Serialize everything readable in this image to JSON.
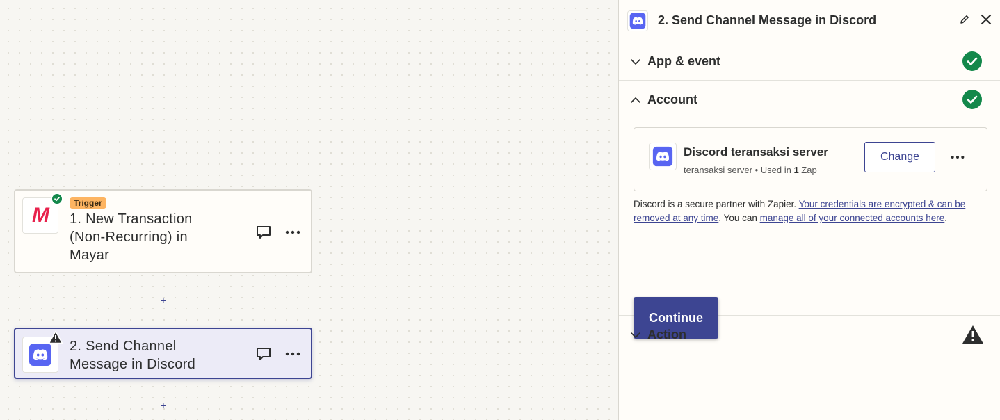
{
  "canvas": {
    "trigger_step": {
      "pill": "Trigger",
      "title": "1. New Transaction (Non-Recurring) in Mayar",
      "logo_letter": "M"
    },
    "action_step": {
      "title": "2. Send Channel Message in Discord"
    },
    "add_step_symbol": "+"
  },
  "panel": {
    "title": "2. Send Channel Message in Discord",
    "sections": {
      "app_event": {
        "label": "App & event",
        "status": "complete"
      },
      "account": {
        "label": "Account",
        "status": "complete"
      },
      "action": {
        "label": "Action",
        "status": "warning"
      }
    },
    "account_card": {
      "name": "Discord teransaksi server",
      "sub_prefix": "teransaksi server • Used in ",
      "sub_count": "1",
      "sub_suffix": " Zap",
      "change_label": "Change"
    },
    "partner": {
      "text_1": "Discord is a secure partner with Zapier. ",
      "link_1": "Your credentials are encrypted & can be removed at any time",
      "text_2": ". You can ",
      "link_2": "manage all of your connected accounts here",
      "text_3": "."
    },
    "continue_label": "Continue"
  },
  "colors": {
    "accent": "#3d4592",
    "success": "#13884b",
    "trigger_pill": "#fdb461",
    "discord": "#5865f2"
  },
  "icons": [
    "discord-icon",
    "mayar-logo",
    "check-icon",
    "warning-icon",
    "comment-icon",
    "more-icon",
    "edit-icon",
    "close-icon",
    "chevron-down-icon",
    "chevron-up-icon"
  ]
}
